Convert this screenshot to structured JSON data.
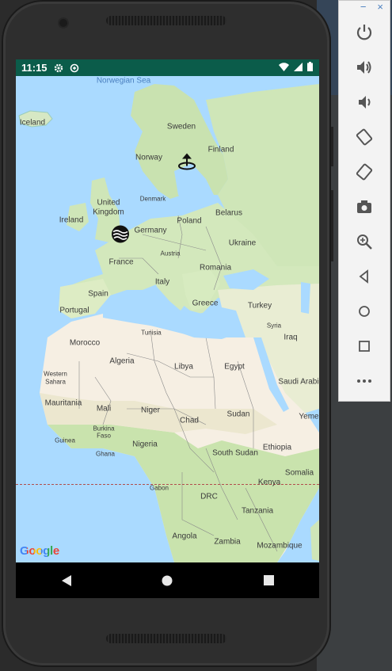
{
  "status_bar": {
    "time": "11:15",
    "icons": [
      "gear-icon",
      "data-saver-icon",
      "wifi-icon",
      "signal-icon",
      "battery-icon"
    ],
    "background": "#0b5c4a"
  },
  "map": {
    "labels": {
      "norwegian_sea": "Norwegian Sea",
      "iceland": "Iceland",
      "sweden": "Sweden",
      "finland": "Finland",
      "norway": "Norway",
      "denmark": "Denmark",
      "united_kingdom_1": "United",
      "united_kingdom_2": "Kingdom",
      "ireland": "Ireland",
      "belarus": "Belarus",
      "poland": "Poland",
      "germany": "Germany",
      "ukraine": "Ukraine",
      "austria": "Austria",
      "france": "France",
      "romania": "Romania",
      "italy": "Italy",
      "spain": "Spain",
      "portugal": "Portugal",
      "greece": "Greece",
      "turkey": "Turkey",
      "syria": "Syria",
      "tunisia": "Tunisia",
      "morocco": "Morocco",
      "iraq": "Iraq",
      "algeria": "Algeria",
      "libya": "Libya",
      "egypt": "Egypt",
      "western_sahara_1": "Western",
      "western_sahara_2": "Sahara",
      "saudi_arabia": "Saudi Arabi",
      "mauritania": "Mauritania",
      "mali": "Mali",
      "niger": "Niger",
      "chad": "Chad",
      "sudan": "Sudan",
      "yemen": "Yeme",
      "burkina_1": "Burkina",
      "burkina_2": "Faso",
      "guinea": "Guinea",
      "ghana": "Ghana",
      "nigeria": "Nigeria",
      "ethiopia": "Ethiopia",
      "south_sudan": "South Sudan",
      "somalia": "Somalia",
      "gabon": "Gabon",
      "kenya": "Kenya",
      "drc": "DRC",
      "tanzania": "Tanzania",
      "angola": "Angola",
      "zambia": "Zambia",
      "mozambique": "Mozambique"
    },
    "attribution": "Google",
    "colors": {
      "water": "#aadaff",
      "land_green": "#cfe6b8",
      "land_desert": "#f6efe3"
    }
  },
  "nav_bar": [
    "back-icon",
    "home-icon",
    "recents-icon"
  ],
  "emulator_toolbar": {
    "window_controls": [
      "−",
      "×"
    ],
    "buttons": [
      "power-icon",
      "volume-up-icon",
      "volume-down-icon",
      "rotate-left-icon",
      "rotate-right-icon",
      "camera-icon",
      "zoom-icon",
      "back-icon",
      "home-icon",
      "overview-icon",
      "more-icon"
    ]
  }
}
